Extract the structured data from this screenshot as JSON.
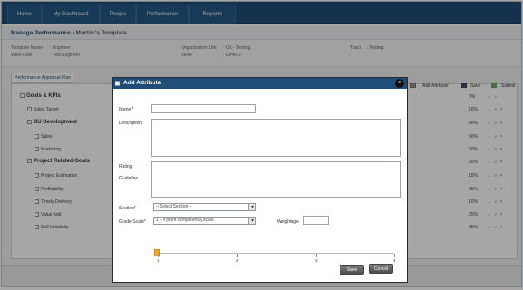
{
  "nav": {
    "tabs": [
      "Home",
      "My Dashboard",
      "People",
      "Performance",
      "Reports"
    ]
  },
  "page": {
    "breadcrumb_main": "Manage Performance",
    "breadcrumb_sep": " › ",
    "breadcrumb_sub": "Martin 's Template"
  },
  "info": {
    "template_name_label": "Template Name",
    "template_name_value": ": Engineer",
    "work_role_label": "Work Role",
    "work_role_value": ": Test Engineer",
    "org_unit_label": "Organization Unit",
    "org_unit_value": ": OL - Testing",
    "level_label": "Level",
    "level_value": ": Level 2",
    "track_label": "Track",
    "track_value": ": Testing"
  },
  "plan_tab": "Performance Appraisal Plan",
  "toolbar": {
    "add_attribute": "Add Attribute",
    "save": "Save",
    "submit": "Submit"
  },
  "rows": [
    {
      "label": "Goals & KPIs",
      "pct": "0%",
      "group": true
    },
    {
      "label": "Sales Target",
      "pct": "10%",
      "group": false
    },
    {
      "label": "BU Development",
      "pct": "40%",
      "group": true
    },
    {
      "label": "Sales",
      "pct": "50%",
      "group": false
    },
    {
      "label": "Marketing",
      "pct": "50%",
      "group": false
    },
    {
      "label": "Project Related Goals",
      "pct": "50%",
      "group": true
    },
    {
      "label": "Project Estimation",
      "pct": "15%",
      "group": false
    },
    {
      "label": "Profitability",
      "pct": "25%",
      "group": false
    },
    {
      "label": "Timely Delivery",
      "pct": "10%",
      "group": false
    },
    {
      "label": "Value Add",
      "pct": "25%",
      "group": false
    },
    {
      "label": "Self Initiativity",
      "pct": "25%",
      "group": false
    }
  ],
  "modal": {
    "title": "Add Attribute",
    "name_label": "Name*",
    "description_label": "Description",
    "rating_label": "Rating",
    "guideline_label": "Guideline",
    "section_label": "Section*",
    "section_value": "--Select Section--",
    "grade_scale_label": "Grade Scale*",
    "grade_scale_value": "1 - 4 point competency scale",
    "weightage_label": "Weightage",
    "slider_marks": [
      "1",
      "2",
      "3",
      "4"
    ],
    "save_button": "Save",
    "cancel_button": "Cancel"
  },
  "colors": {
    "nav_bg": "#204d77",
    "handle": "#f3a52a"
  }
}
